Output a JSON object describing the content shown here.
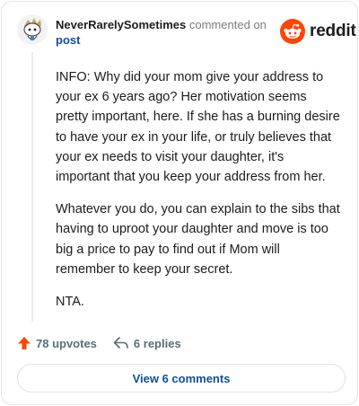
{
  "header": {
    "username": "NeverRarelySometimes",
    "commented": "commented on",
    "post_link": "post"
  },
  "brand": {
    "wordmark": "reddit",
    "icon": "reddit-alien-icon",
    "color": "#ff4500"
  },
  "comment": {
    "paragraphs": [
      "INFO: Why did your mom give your address to your ex 6 years ago? Her motivation seems pretty important, here. If she has a burning desire to have your ex in your life, or truly believes that your ex needs to visit your daughter, it's important that you keep your address from her.",
      "Whatever you do, you can explain to the sibs that having to uproot your daughter and move is too big a price to pay to find out if Mom will remember to keep your secret.",
      "NTA."
    ]
  },
  "actions": {
    "upvotes": "78 upvotes",
    "replies": "6 replies",
    "upvote_icon": "upvote-arrow-icon",
    "reply_icon": "reply-arrow-icon"
  },
  "footer": {
    "view_comments": "View 6 comments"
  },
  "colors": {
    "accent": "#ff4500",
    "link": "#0f4fa0",
    "muted": "#576f76"
  }
}
